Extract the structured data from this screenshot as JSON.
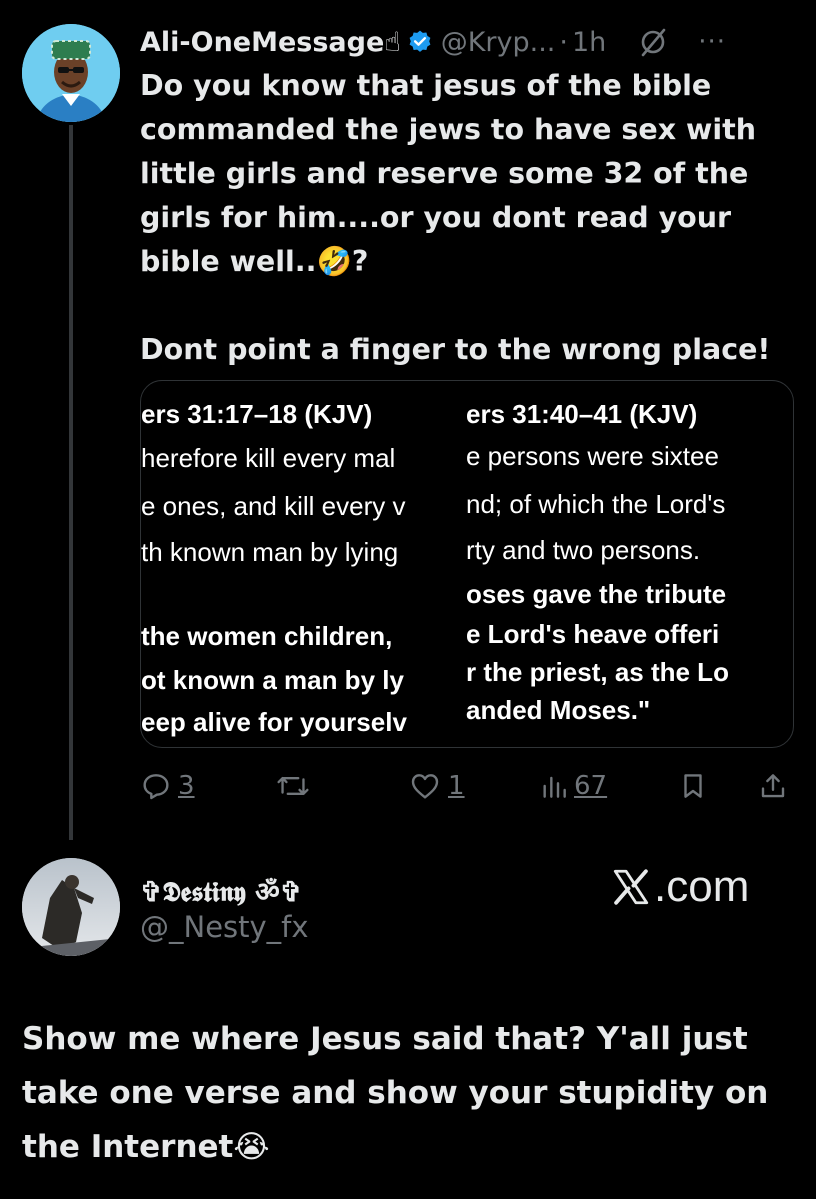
{
  "tweet": {
    "author_name": "Ali-OneMessage☝",
    "handle": "@Kryp...",
    "separator": "·",
    "time": "1h",
    "more_label": "···",
    "text": "Do you know that jesus of the bible commanded the jews to have sex with little girls and reserve some 32 of the girls for him....or you dont read your bible well..🤣?\n\nDont point a finger to the wrong place!",
    "media": {
      "left_lines": [
        "ers 31:17–18 (KJV)",
        "herefore kill every mal",
        "e ones, and kill every v",
        "th known man by lying",
        "the women children,",
        "ot known a man by ly",
        "eep alive for yourselv"
      ],
      "right_lines": [
        "ers 31:40–41 (KJV)",
        "e persons were sixtee",
        "nd; of which the Lord's",
        "rty and two persons.",
        "oses gave the tribute",
        "e Lord's heave offeri",
        "r the priest, as the Lo",
        "anded Moses.\""
      ]
    },
    "actions": {
      "replies": "3",
      "retweets": "",
      "likes": "1",
      "views": "67"
    }
  },
  "reply": {
    "author_name": "✞𝕯𝖊𝖘𝖙𝖎𝖓𝖞 ॐ✞",
    "handle": "@_Nesty_fx",
    "text": "Show me where Jesus said that? Y'all just take one verse and show your stupidity on the Internet😭"
  },
  "watermark": ".com",
  "colors": {
    "background": "#000000",
    "text": "#e7e9ea",
    "muted": "#71767b",
    "verified": "#1d9bf0",
    "border": "#2f3336"
  }
}
